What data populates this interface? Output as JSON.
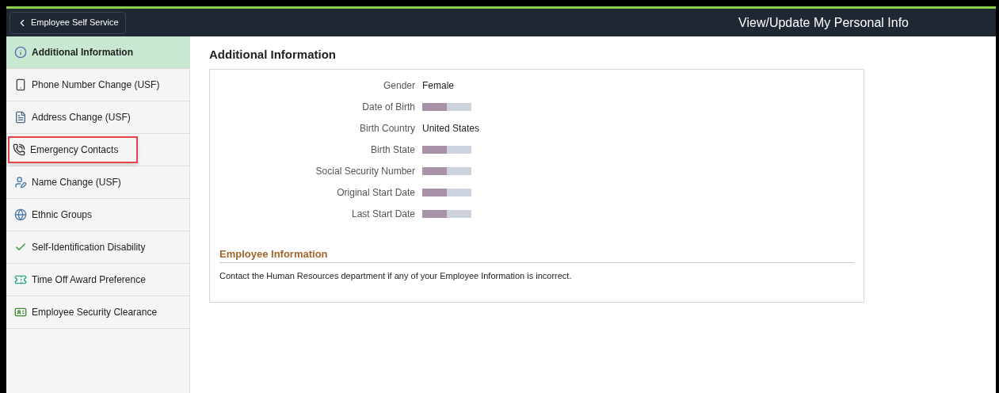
{
  "header": {
    "back_button": "Employee Self Service",
    "title": "View/Update My Personal Info"
  },
  "sidebar": {
    "items": [
      {
        "label": "Additional Information",
        "selected": true,
        "highlighted": false
      },
      {
        "label": "Phone Number Change (USF)",
        "selected": false,
        "highlighted": false
      },
      {
        "label": "Address Change (USF)",
        "selected": false,
        "highlighted": false
      },
      {
        "label": "Emergency Contacts",
        "selected": false,
        "highlighted": true
      },
      {
        "label": "Name Change (USF)",
        "selected": false,
        "highlighted": false
      },
      {
        "label": "Ethnic Groups",
        "selected": false,
        "highlighted": false
      },
      {
        "label": "Self-Identification Disability",
        "selected": false,
        "highlighted": false
      },
      {
        "label": "Time Off Award Preference",
        "selected": false,
        "highlighted": false
      },
      {
        "label": "Employee Security Clearance",
        "selected": false,
        "highlighted": false
      }
    ]
  },
  "content": {
    "title": "Additional Information",
    "fields": [
      {
        "label": "Gender",
        "kind": "text",
        "value": "Female"
      },
      {
        "label": "Date of Birth",
        "kind": "redacted"
      },
      {
        "label": "Birth Country",
        "kind": "text",
        "value": "United States"
      },
      {
        "label": "Birth State",
        "kind": "redacted"
      },
      {
        "label": "Social Security Number",
        "kind": "redacted"
      },
      {
        "label": "Original Start Date",
        "kind": "redacted"
      },
      {
        "label": "Last Start Date",
        "kind": "redacted"
      }
    ],
    "section": {
      "title": "Employee Information",
      "note": "Contact the Human Resources department if any of your Employee Information is incorrect."
    }
  }
}
